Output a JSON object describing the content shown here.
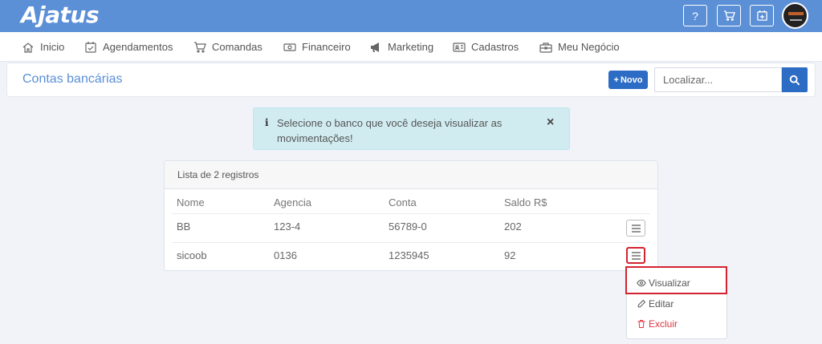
{
  "app": {
    "logo_text": "Ajatus"
  },
  "topbar": {
    "help_label": "?",
    "icons": [
      "help-icon",
      "cart-icon",
      "calendar-add-icon",
      "user-avatar"
    ]
  },
  "nav": {
    "items": [
      {
        "label": "Inicio",
        "icon": "home-icon"
      },
      {
        "label": "Agendamentos",
        "icon": "calendar-check-icon"
      },
      {
        "label": "Comandas",
        "icon": "cart-icon"
      },
      {
        "label": "Financeiro",
        "icon": "money-icon"
      },
      {
        "label": "Marketing",
        "icon": "megaphone-icon"
      },
      {
        "label": "Cadastros",
        "icon": "id-card-icon"
      },
      {
        "label": "Meu Negócio",
        "icon": "briefcase-icon"
      }
    ]
  },
  "header": {
    "title": "Contas bancárias",
    "new_button_label": "Novo",
    "search_placeholder": "Localizar..."
  },
  "alert": {
    "icon": "i",
    "message": "Selecione o banco que você deseja visualizar as movimentações!",
    "close_label": "×"
  },
  "list": {
    "summary": "Lista de 2 registros",
    "columns": [
      "Nome",
      "Agencia",
      "Conta",
      "Saldo R$"
    ],
    "rows": [
      {
        "nome": "BB",
        "agencia": "123-4",
        "conta": "56789-0",
        "saldo": "202"
      },
      {
        "nome": "sicoob",
        "agencia": "0136",
        "conta": "1235945",
        "saldo": "92"
      }
    ]
  },
  "dropdown": {
    "items": [
      {
        "label": "Visualizar",
        "icon": "eye-icon"
      },
      {
        "label": "Editar",
        "icon": "pencil-icon"
      },
      {
        "label": "Excluir",
        "icon": "trash-icon"
      }
    ]
  },
  "colors": {
    "topbar": "#5b8fd6",
    "primary_button": "#2d6cc4",
    "highlight": "#d42330",
    "danger": "#e0333f",
    "alert_bg": "#d1ecf1"
  }
}
